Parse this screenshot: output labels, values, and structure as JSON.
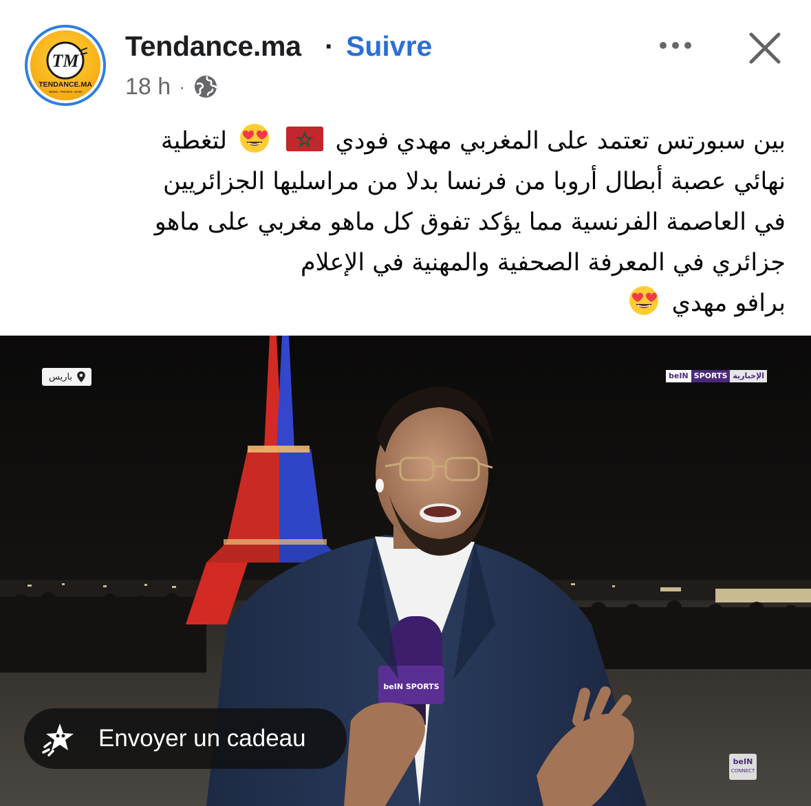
{
  "post": {
    "page_name": "Tendance.ma",
    "separator": "·",
    "follow_label": "Suivre",
    "timestamp": "18 h",
    "meta_separator": "·",
    "audience_icon": "globe-icon",
    "more_icon": "more-options-icon",
    "close_icon": "close-icon",
    "avatar": {
      "logo_text": "TM",
      "brand_text": "TENDANCE.MA",
      "tagline_text": "NEWS. TRENDS. NOW",
      "ring_color": "#2f7de1",
      "background_color": "#f9b21a"
    }
  },
  "text": {
    "line1_before": "بين سبورتس تعتمد على المغربي مهدي فودي",
    "line1_after": "لتغطية",
    "line2": "نهائي عصبة أبطال أروبا من فرنسا بدلا من مراسليها الجزائريين",
    "line3": "في العاصمة الفرنسية مما يؤكد تفوق كل ماهو مغربي على ماهو",
    "line4": "جزائري في المعرفة الصحفية  والمهنية في الإعلام",
    "line5": "برافو مهدي",
    "flag_icon": "morocco-flag-icon",
    "emoji_icon": "heart-eyes-emoji-icon"
  },
  "video": {
    "location_label": "باريس",
    "location_icon": "location-pin-icon",
    "channel_logo": {
      "brand": "beIN",
      "sports": "SPORTS",
      "news": "الإخبارية"
    },
    "mic_logo": "beIN SPORTS",
    "connect_logo": {
      "brand": "beIN",
      "sub": "CONNECT"
    },
    "gift_button_label": "Envoyer un cadeau",
    "gift_icon": "gift-sparkle-icon"
  },
  "colors": {
    "link_blue": "#2c6fd4",
    "meta_gray": "#65676b",
    "tower_red": "#e0241f",
    "tower_blue": "#2f43c9"
  }
}
